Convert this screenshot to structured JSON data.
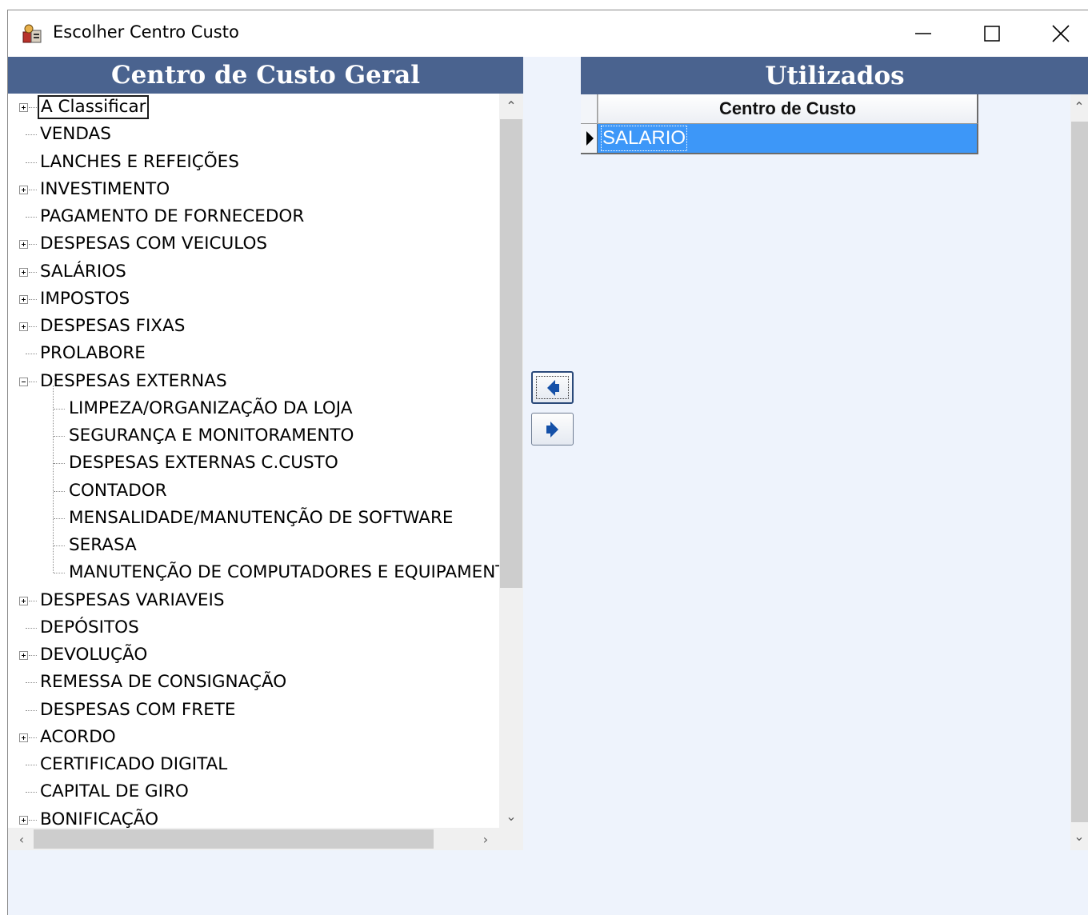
{
  "window": {
    "title": "Escolher Centro Custo",
    "minimize_icon": "minimize-icon",
    "maximize_icon": "maximize-icon",
    "close_icon": "close-icon"
  },
  "left_panel": {
    "header": "Centro de Custo Geral",
    "tree": [
      {
        "label": "A Classificar",
        "level": 0,
        "expander": "plus",
        "focused": true
      },
      {
        "label": "VENDAS",
        "level": 0,
        "expander": "none"
      },
      {
        "label": "LANCHES E REFEIÇÕES",
        "level": 0,
        "expander": "none"
      },
      {
        "label": "INVESTIMENTO",
        "level": 0,
        "expander": "plus"
      },
      {
        "label": "PAGAMENTO DE FORNECEDOR",
        "level": 0,
        "expander": "none"
      },
      {
        "label": "DESPESAS COM VEICULOS",
        "level": 0,
        "expander": "plus"
      },
      {
        "label": "SALÁRIOS",
        "level": 0,
        "expander": "plus"
      },
      {
        "label": "IMPOSTOS",
        "level": 0,
        "expander": "plus"
      },
      {
        "label": "DESPESAS FIXAS",
        "level": 0,
        "expander": "plus"
      },
      {
        "label": "PROLABORE",
        "level": 0,
        "expander": "none"
      },
      {
        "label": "DESPESAS EXTERNAS",
        "level": 0,
        "expander": "minus"
      },
      {
        "label": "LIMPEZA/ORGANIZAÇÃO DA LOJA",
        "level": 1,
        "expander": "none"
      },
      {
        "label": "SEGURANÇA E MONITORAMENTO",
        "level": 1,
        "expander": "none"
      },
      {
        "label": "DESPESAS EXTERNAS  C.CUSTO",
        "level": 1,
        "expander": "none"
      },
      {
        "label": "CONTADOR",
        "level": 1,
        "expander": "none"
      },
      {
        "label": "MENSALIDADE/MANUTENÇÃO DE SOFTWARE",
        "level": 1,
        "expander": "none"
      },
      {
        "label": "SERASA",
        "level": 1,
        "expander": "none"
      },
      {
        "label": "MANUTENÇÃO DE COMPUTADORES E EQUIPAMENTOS",
        "level": 1,
        "expander": "none"
      },
      {
        "label": "DESPESAS VARIAVEIS",
        "level": 0,
        "expander": "plus"
      },
      {
        "label": "DEPÓSITOS",
        "level": 0,
        "expander": "none"
      },
      {
        "label": "DEVOLUÇÃO",
        "level": 0,
        "expander": "plus"
      },
      {
        "label": "REMESSA DE CONSIGNAÇÃO",
        "level": 0,
        "expander": "none"
      },
      {
        "label": "DESPESAS COM FRETE",
        "level": 0,
        "expander": "none"
      },
      {
        "label": "ACORDO",
        "level": 0,
        "expander": "plus"
      },
      {
        "label": "CERTIFICADO DIGITAL",
        "level": 0,
        "expander": "none"
      },
      {
        "label": "CAPITAL DE GIRO",
        "level": 0,
        "expander": "none"
      },
      {
        "label": "BONIFICAÇÃO",
        "level": 0,
        "expander": "plus"
      }
    ]
  },
  "move_buttons": {
    "remove_icon": "arrow-left-icon",
    "add_icon": "arrow-right-icon"
  },
  "right_panel": {
    "header": "Utilizados",
    "column_header": "Centro de Custo",
    "rows": [
      "SALARIO"
    ]
  },
  "colors": {
    "panel_header_bg": "#4a638f",
    "selection_bg": "#3d97f8",
    "form_bg": "#eef3fc"
  }
}
